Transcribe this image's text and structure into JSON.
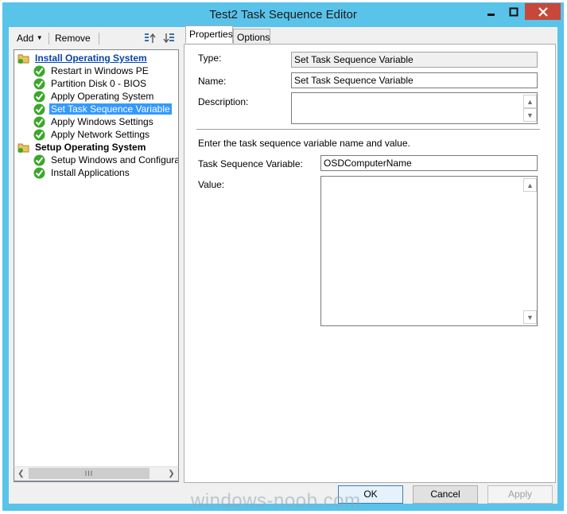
{
  "window": {
    "title": "Test2 Task Sequence Editor"
  },
  "toolbar": {
    "add_label": "Add",
    "remove_label": "Remove"
  },
  "tree": {
    "groups": [
      {
        "label": "Install Operating System",
        "items": [
          "Restart in Windows PE",
          "Partition Disk 0 - BIOS",
          "Apply Operating System",
          "Set Task Sequence Variable",
          "Apply Windows Settings",
          "Apply Network Settings"
        ]
      },
      {
        "label": "Setup Operating System",
        "items": [
          "Setup Windows and Configuration",
          "Install Applications"
        ]
      }
    ],
    "selected": "Set Task Sequence Variable",
    "scroll_thumb": "III"
  },
  "tabs": [
    "Properties",
    "Options"
  ],
  "active_tab": "Properties",
  "form": {
    "type_label": "Type:",
    "type_value": "Set Task Sequence Variable",
    "name_label": "Name:",
    "name_value": "Set Task Sequence Variable",
    "description_label": "Description:",
    "description_value": "",
    "instruction": "Enter the task sequence variable name and value.",
    "variable_label": "Task Sequence Variable:",
    "variable_value": "OSDComputerName",
    "value_label": "Value:",
    "value_value": ""
  },
  "buttons": {
    "ok": "OK",
    "cancel": "Cancel",
    "apply": "Apply"
  },
  "watermark": "windows-noob.com",
  "colors": {
    "titlebar": "#5ac3ea",
    "close": "#c7483a",
    "selection": "#3399ff",
    "check": "#3aa829"
  }
}
